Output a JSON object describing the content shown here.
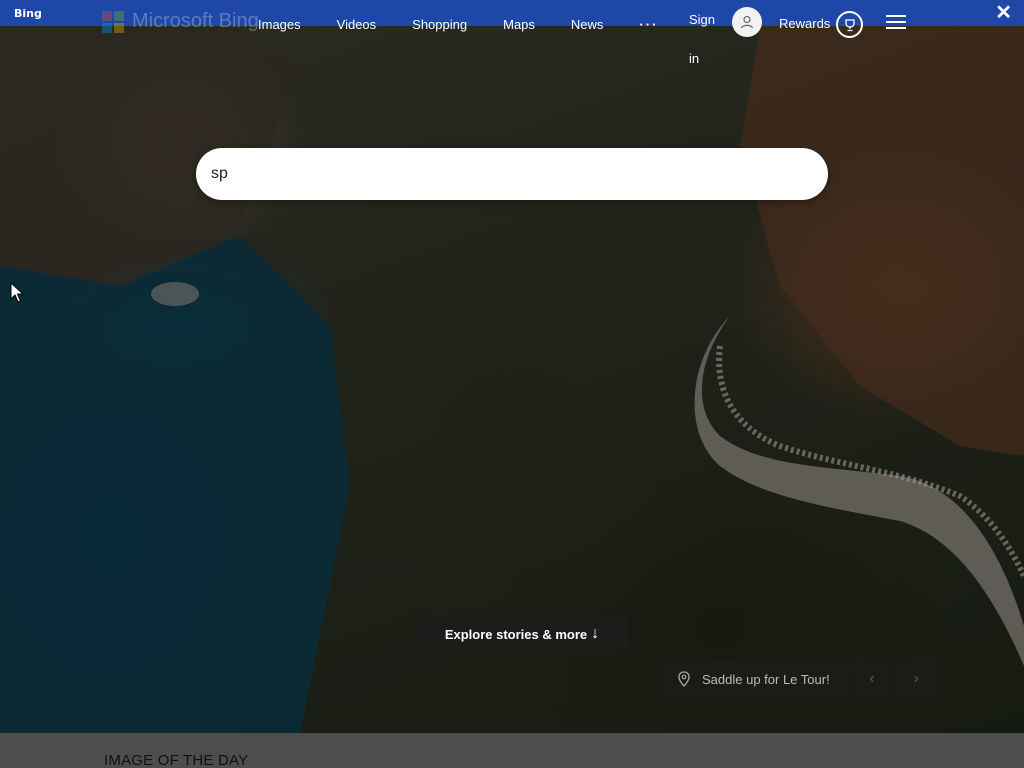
{
  "window": {
    "title": "Bing",
    "close_glyph": "✕"
  },
  "logo": {
    "text": "Microsoft Bing"
  },
  "nav": {
    "items": [
      {
        "label": "Images"
      },
      {
        "label": "Videos"
      },
      {
        "label": "Shopping"
      },
      {
        "label": "Maps"
      },
      {
        "label": "News"
      }
    ],
    "more_label": "···"
  },
  "header": {
    "sign_in_label": "Sign in",
    "rewards_label": "Rewards"
  },
  "search": {
    "value": "sp"
  },
  "explore": {
    "label": "Explore stories & more",
    "arrow": "↓"
  },
  "image_caption": {
    "label": "Saddle up for Le Tour!",
    "prev": "‹",
    "next": "›"
  },
  "iotd": {
    "label": "IMAGE OF THE DAY"
  },
  "colors": {
    "titlebar": "#1e47a8",
    "search_icon": "#0e7ac4"
  }
}
